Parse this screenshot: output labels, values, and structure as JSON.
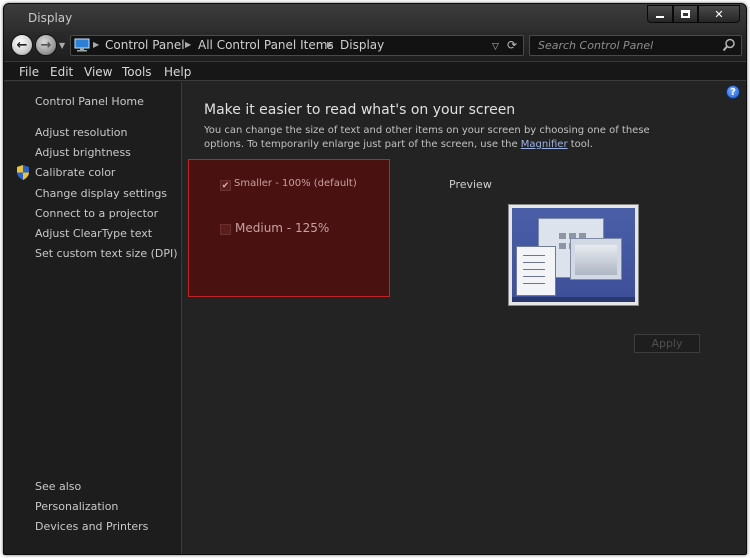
{
  "window": {
    "title": "Display"
  },
  "navbar": {
    "breadcrumbs": [
      "Control Panel",
      "All Control Panel Items",
      "Display"
    ],
    "search_placeholder": "Search Control Panel"
  },
  "menubar": {
    "items": [
      "File",
      "Edit",
      "View",
      "Tools",
      "Help"
    ]
  },
  "sidebar": {
    "home": "Control Panel Home",
    "links": [
      "Adjust resolution",
      "Adjust brightness",
      "Calibrate color",
      "Change display settings",
      "Connect to a projector",
      "Adjust ClearType text",
      "Set custom text size (DPI)"
    ],
    "see_also_title": "See also",
    "see_also": [
      "Personalization",
      "Devices and Printers"
    ]
  },
  "main": {
    "heading": "Make it easier to read what's on your screen",
    "description_before": "You can change the size of text and other items on your screen by choosing one of these options. To temporarily enlarge just part of the screen, use the ",
    "magnifier_link": "Magnifier",
    "description_after": " tool.",
    "options": [
      {
        "label": "Smaller - 100% (default)",
        "selected": true
      },
      {
        "label": "Medium - 125%",
        "selected": false
      }
    ],
    "preview_label": "Preview",
    "apply_label": "Apply"
  },
  "colors": {
    "highlight_fill": "#4a1111",
    "highlight_border": "#c02525",
    "link": "#9db3e6"
  }
}
